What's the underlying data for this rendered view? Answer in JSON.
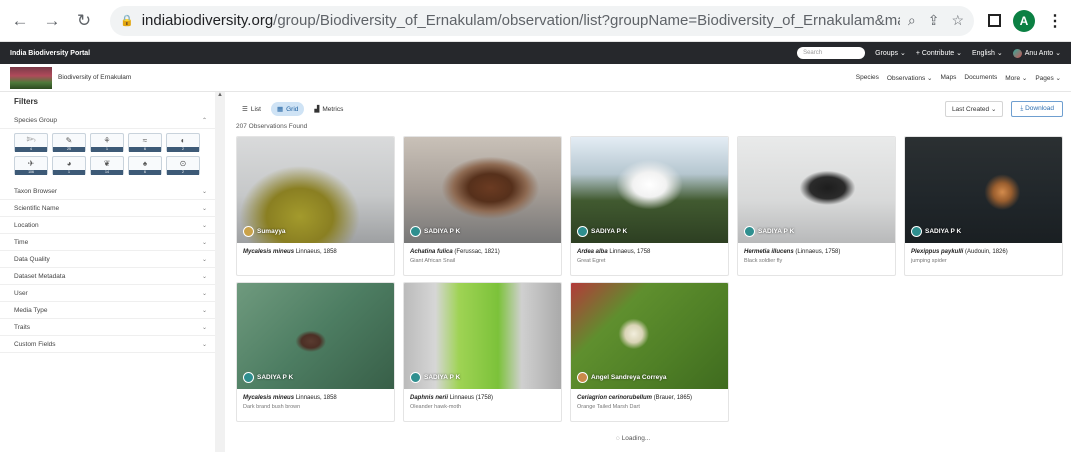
{
  "browser": {
    "url_host": "indiabiodiversity.org",
    "url_path": "/group/Biodiversity_of_Ernakulam/observation/list?groupName=Biodiversity_of_Ernakulam&max=8&offset=0&sort=created_on...",
    "profile_initial": "A"
  },
  "portal": {
    "title": "India Biodiversity Portal",
    "search_placeholder": "Search",
    "groups": "Groups ⌄",
    "contribute": "+ Contribute ⌄",
    "language": "English ⌄",
    "user": "Anu Anto ⌄"
  },
  "group": {
    "name": "Biodiversity of Ernakulam",
    "nav": [
      "Species",
      "Observations ⌄",
      "Maps",
      "Documents",
      "More ⌄",
      "Pages ⌄"
    ]
  },
  "filters": {
    "title": "Filters",
    "species_group_label": "Species Group",
    "species_tiles": [
      {
        "icon": "𓆸",
        "count": "4"
      },
      {
        "icon": "✎",
        "count": "25"
      },
      {
        "icon": "⚘",
        "count": "1"
      },
      {
        "icon": "≈",
        "count": "6"
      },
      {
        "icon": "◐",
        "count": "2"
      },
      {
        "icon": "✈",
        "count": "106"
      },
      {
        "icon": "◕",
        "count": "1"
      },
      {
        "icon": "❦",
        "count": "14"
      },
      {
        "icon": "♠",
        "count": "6"
      },
      {
        "icon": "⊙",
        "count": "2"
      }
    ],
    "rows": [
      "Taxon Browser",
      "Scientific Name",
      "Location",
      "Time",
      "Data Quality",
      "Dataset Metadata",
      "User",
      "Media Type",
      "Traits",
      "Custom Fields"
    ]
  },
  "toolbar": {
    "tabs": [
      "List",
      "Grid",
      "Metrics"
    ],
    "sort": "Last Created  ⌄",
    "download": "⤓  Download"
  },
  "results": {
    "count_text": "207 Observations Found",
    "loading": "Loading..."
  },
  "cards": [
    {
      "user": "Sumayya",
      "sci": "Mycalesis mineus",
      "author": "Linnaeus, 1858",
      "common": "",
      "img": "img-butterfly",
      "dot": "#caa24a"
    },
    {
      "user": "SADIYA P K",
      "sci": "Achatina fulica",
      "author": "(Ferussac, 1821)",
      "common": "Giant African Snail",
      "img": "img-snail",
      "dot": "#2f8f8f"
    },
    {
      "user": "SADIYA P K",
      "sci": "Ardea alba",
      "author": "Linnaeus, 1758",
      "common": "Great Egret",
      "img": "img-egret",
      "dot": "#2f8f8f"
    },
    {
      "user": "SADIYA P K",
      "sci": "Hermetia illucens",
      "author": "(Linnaeus, 1758)",
      "common": "Black soldier fly",
      "img": "img-fly",
      "dot": "#2f8f8f"
    },
    {
      "user": "SADIYA P K",
      "sci": "Plexippus paykulli",
      "author": "(Audouin, 1826)",
      "common": "jumping spider",
      "img": "img-spider",
      "dot": "#2f8f8f"
    },
    {
      "user": "SADIYA P K",
      "sci": "Mycalesis mineus",
      "author": "Linnaeus, 1858",
      "common": "Dark brand bush brown",
      "img": "img-leaf",
      "dot": "#2f8f8f"
    },
    {
      "user": "SADIYA P K",
      "sci": "Daphnis nerii",
      "author": "Linnaeus (1758)",
      "common": "Oleander hawk-moth",
      "img": "img-caterpillar",
      "dot": "#2f8f8f"
    },
    {
      "user": "Angel Sandreya Correya",
      "sci": "Ceriagrion cerinorubellum",
      "author": "(Brauer, 1865)",
      "common": "Orange Tailed Marsh Dart",
      "img": "img-flower",
      "dot": "#c98a4a"
    }
  ]
}
